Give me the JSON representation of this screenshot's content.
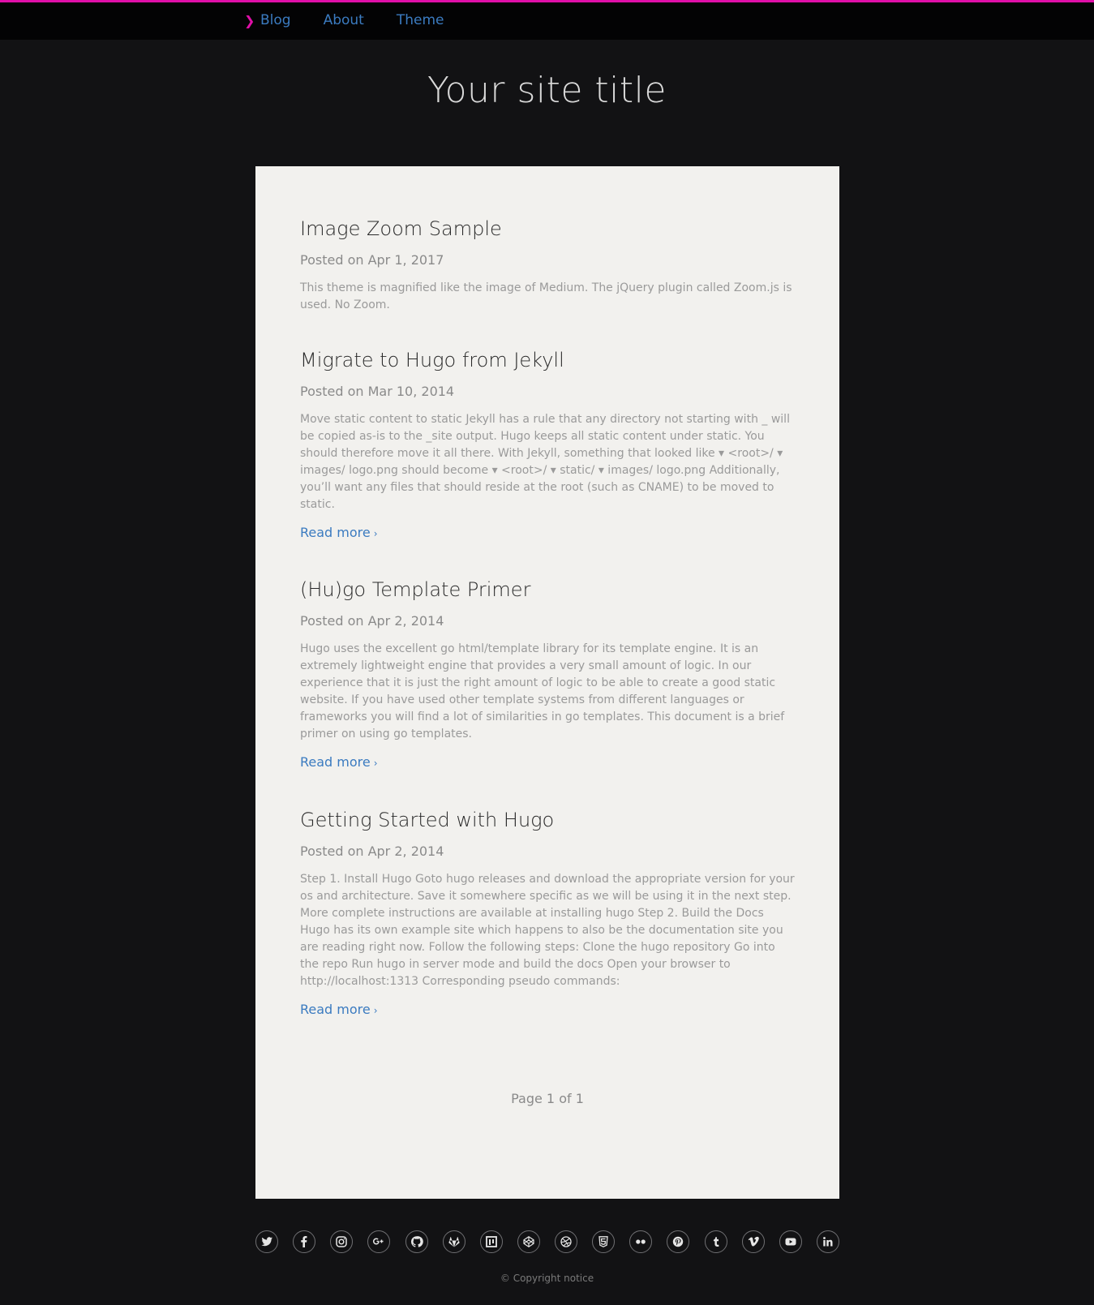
{
  "nav": {
    "items": [
      {
        "label": "Blog"
      },
      {
        "label": "About"
      },
      {
        "label": "Theme"
      }
    ]
  },
  "site": {
    "title": "Your site title"
  },
  "posts": [
    {
      "title": "Image Zoom Sample",
      "date": "Posted on Apr 1, 2017",
      "summary": "This theme is magnified like the image of Medium. The jQuery plugin called Zoom.js is used. No Zoom."
    },
    {
      "title": "Migrate to Hugo from Jekyll",
      "date": "Posted on Mar 10, 2014",
      "summary": "Move static content to static Jekyll has a rule that any directory not starting with _ will be copied as-is to the _site output. Hugo keeps all static content under static. You should therefore move it all there. With Jekyll, something that looked like ▾ <root>/ ▾ images/ logo.png should become ▾ <root>/ ▾ static/ ▾ images/ logo.png Additionally, you’ll want any files that should reside at the root (such as CNAME) to be moved to static.",
      "read_more": "Read more"
    },
    {
      "title": "(Hu)go Template Primer",
      "date": "Posted on Apr 2, 2014",
      "summary": "Hugo uses the excellent go html/template library for its template engine. It is an extremely lightweight engine that provides a very small amount of logic. In our experience that it is just the right amount of logic to be able to create a good static website. If you have used other template systems from different languages or frameworks you will find a lot of similarities in go templates. This document is a brief primer on using go templates.",
      "read_more": "Read more"
    },
    {
      "title": "Getting Started with Hugo",
      "date": "Posted on Apr 2, 2014",
      "summary": "Step 1. Install Hugo Goto hugo releases and download the appropriate version for your os and architecture. Save it somewhere specific as we will be using it in the next step. More complete instructions are available at installing hugo Step 2. Build the Docs Hugo has its own example site which happens to also be the documentation site you are reading right now. Follow the following steps: Clone the hugo repository Go into the repo Run hugo in server mode and build the docs Open your browser to http://localhost:1313 Corresponding pseudo commands:",
      "read_more": "Read more"
    }
  ],
  "pager": {
    "text": "Page 1 of 1"
  },
  "social": [
    {
      "icon": "twitter-icon"
    },
    {
      "icon": "facebook-icon"
    },
    {
      "icon": "instagram-icon"
    },
    {
      "icon": "google-plus-icon"
    },
    {
      "icon": "github-icon"
    },
    {
      "icon": "gitlab-icon"
    },
    {
      "icon": "stack-icon"
    },
    {
      "icon": "codepen-icon"
    },
    {
      "icon": "dribbble-icon"
    },
    {
      "icon": "html5-icon"
    },
    {
      "icon": "flickr-icon"
    },
    {
      "icon": "pinterest-icon"
    },
    {
      "icon": "tumblr-icon"
    },
    {
      "icon": "vimeo-icon"
    },
    {
      "icon": "youtube-icon"
    },
    {
      "icon": "linkedin-icon"
    }
  ],
  "footer": {
    "copyright": "© Copyright notice"
  },
  "colors": {
    "accent": "#e00fa8",
    "link": "#3b7bc0",
    "background": "#121214",
    "card": "#f2f1ee"
  }
}
